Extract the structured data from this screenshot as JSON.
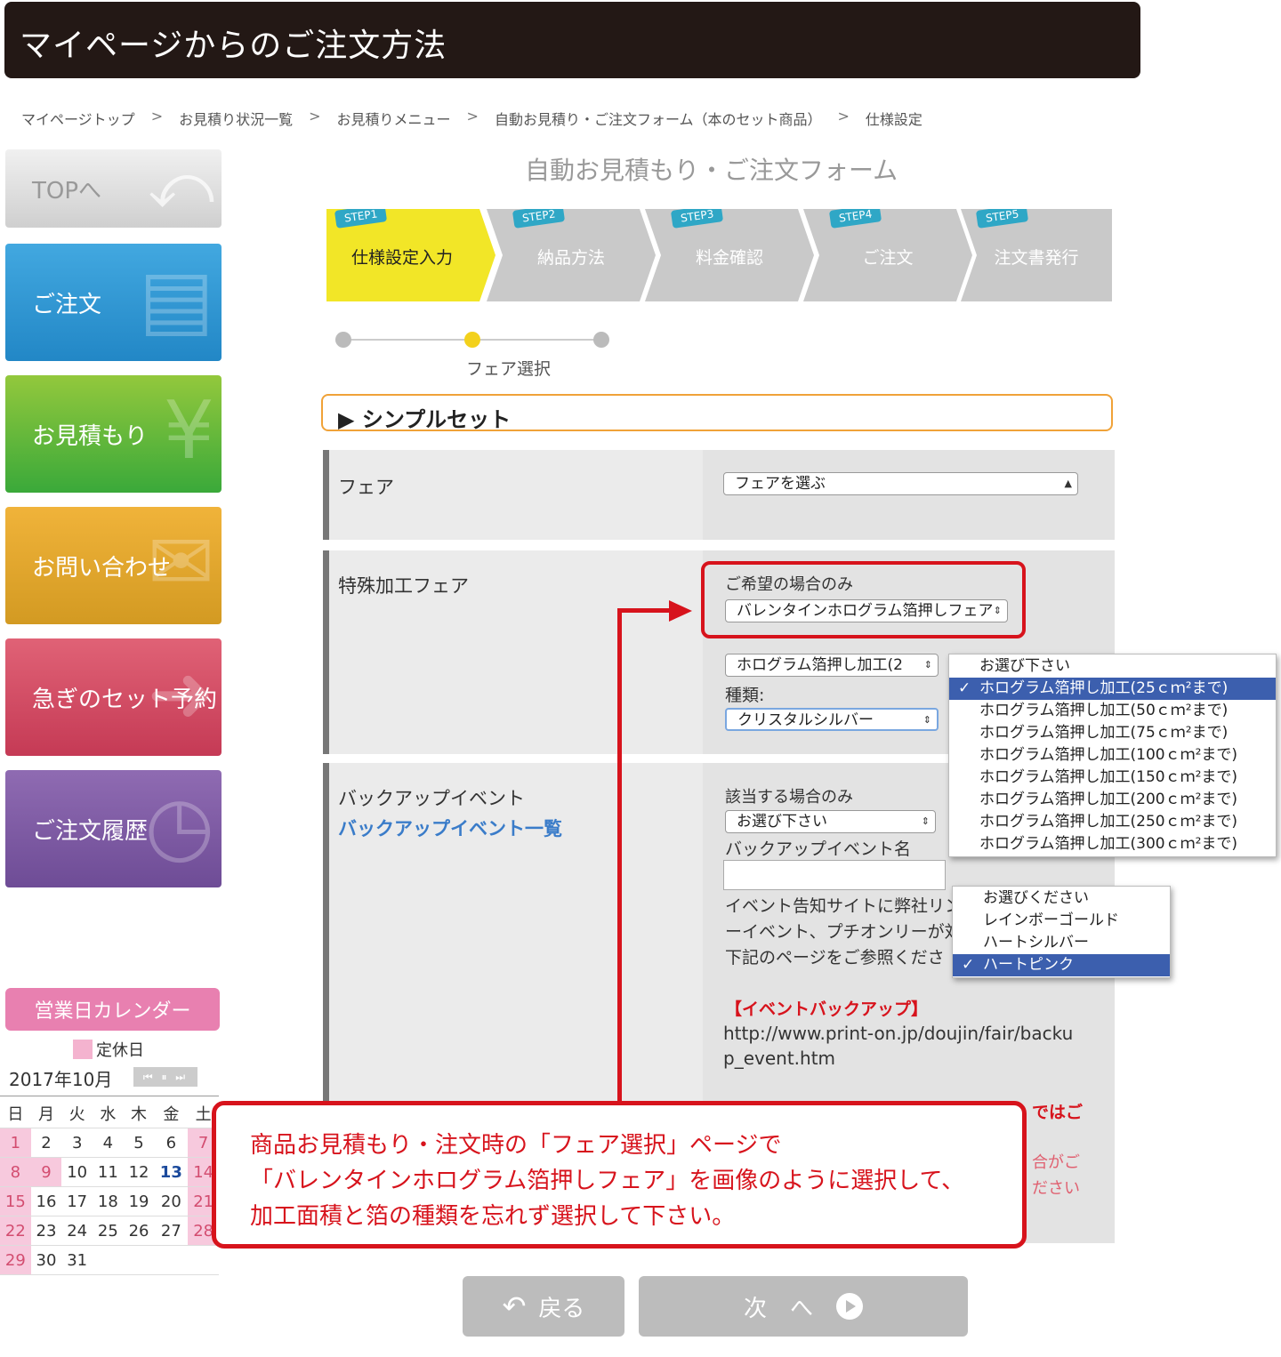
{
  "header": {
    "title": "マイページからのご注文方法"
  },
  "breadcrumb": {
    "items": [
      "マイページトップ",
      "お見積り状況一覧",
      "お見積りメニュー",
      "自動お見積り・ご注文フォーム（本のセット商品）",
      "仕様設定"
    ],
    "separator": ">"
  },
  "sidebar": {
    "top": "TOPへ",
    "order": "ご注文",
    "estimate": "お見積もり",
    "contact": "お問い合わせ",
    "urgent": "急ぎのセット予約",
    "history": "ご注文履歴"
  },
  "calendar": {
    "title": "営業日カレンダー",
    "legend": "定休日",
    "month": "2017年10月",
    "nav": "⏮ ⏸ ⏭",
    "weekdays": [
      "日",
      "月",
      "火",
      "水",
      "木",
      "金",
      "土"
    ],
    "weeks": [
      [
        "1",
        "2",
        "3",
        "4",
        "5",
        "6",
        "7"
      ],
      [
        "8",
        "9",
        "10",
        "11",
        "12",
        "13",
        "14"
      ],
      [
        "15",
        "16",
        "17",
        "18",
        "19",
        "20",
        "21"
      ],
      [
        "22",
        "23",
        "24",
        "25",
        "26",
        "27",
        "28"
      ],
      [
        "29",
        "30",
        "31",
        "",
        "",
        "",
        ""
      ]
    ],
    "today": "13"
  },
  "form": {
    "title": "自動お見積もり・ご注文フォーム",
    "steps": [
      {
        "tag": "STEP1",
        "label": "仕様設定入力"
      },
      {
        "tag": "STEP2",
        "label": "納品方法"
      },
      {
        "tag": "STEP3",
        "label": "料金確認"
      },
      {
        "tag": "STEP4",
        "label": "ご注文"
      },
      {
        "tag": "STEP5",
        "label": "注文書発行"
      }
    ],
    "substep_label": "フェア選択",
    "section_title": "シンプルセット",
    "fair": {
      "label": "フェア",
      "select": "フェアを選ぶ"
    },
    "special": {
      "label": "特殊加工フェア",
      "note": "ご希望の場合のみ",
      "select": "バレンタインホログラム箔押しフェア",
      "area_select": "ホログラム箔押し加工(2",
      "kind_label": "種類:",
      "kind_select": "クリスタルシルバー"
    },
    "backup": {
      "label": "バックアップイベント",
      "link": "バックアップイベント一覧",
      "note": "該当する場合のみ",
      "select": "お選び下さい",
      "name_label": "バックアップイベント名",
      "desc1": "イベント告知サイトに弊社リン",
      "desc2": "ーイベント、プチオンリーが対",
      "desc3": "下記のページをご参照くださ",
      "event_heading": "【イベントバックアップ】",
      "url1": "http://www.print-on.jp/doujin/fair/backu",
      "url2": "p_event.htm",
      "red1": "ではご",
      "red2": "合がご",
      "red3": "ださい"
    }
  },
  "dropdown_area": {
    "items": [
      "お選び下さい",
      "ホログラム箔押し加工(25ｃｍ²まで)",
      "ホログラム箔押し加工(50ｃｍ²まで)",
      "ホログラム箔押し加工(75ｃｍ²まで)",
      "ホログラム箔押し加工(100ｃｍ²まで)",
      "ホログラム箔押し加工(150ｃｍ²まで)",
      "ホログラム箔押し加工(200ｃｍ²まで)",
      "ホログラム箔押し加工(250ｃｍ²まで)",
      "ホログラム箔押し加工(300ｃｍ²まで)"
    ],
    "selected_index": 1
  },
  "dropdown_kind": {
    "items": [
      "お選びください",
      "レインボーゴールド",
      "ハートシルバー",
      "ハートピンク"
    ],
    "selected_index": 3
  },
  "notice": {
    "line1": "商品お見積もり・注文時の「フェア選択」ページで",
    "line2": "「バレンタインホログラム箔押しフェア」を画像のように選択して、",
    "line3": "加工面積と箔の種類を忘れず選択して下さい。"
  },
  "buttons": {
    "back": "戻る",
    "next": "次　へ"
  },
  "colors": {
    "accent_red": "#d7131c",
    "step_active": "#f2e627",
    "section_border": "#f0a238"
  }
}
